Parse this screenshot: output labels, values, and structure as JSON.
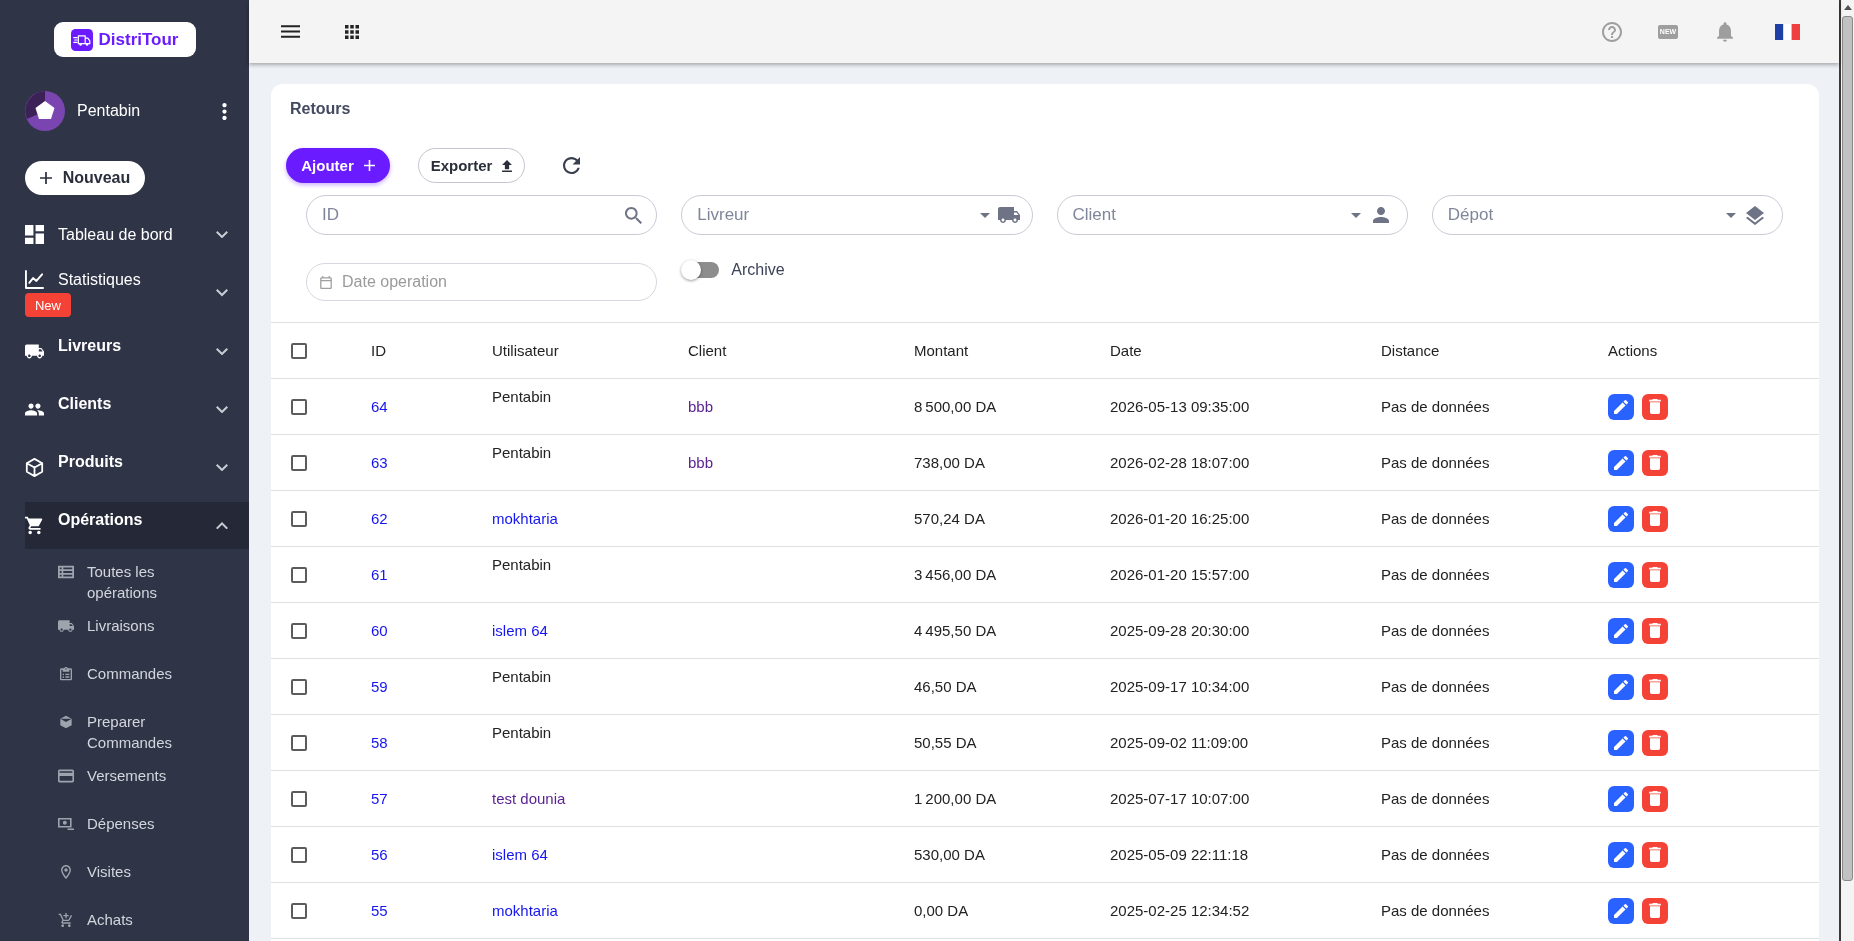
{
  "sidebar": {
    "brand": "DistriTour",
    "user": {
      "name": "Pentabin"
    },
    "new_button": {
      "label": "Nouveau"
    },
    "items": [
      {
        "label": "Tableau de bord",
        "bold": false,
        "selected": false,
        "expanded": false
      },
      {
        "label": "Statistiques",
        "badge": "New",
        "bold": false,
        "selected": false,
        "expanded": false
      },
      {
        "label": "Livreurs",
        "bold": true,
        "selected": false,
        "expanded": false
      },
      {
        "label": "Clients",
        "bold": true,
        "selected": false,
        "expanded": false
      },
      {
        "label": "Produits",
        "bold": true,
        "selected": false,
        "expanded": false
      },
      {
        "label": "Opérations",
        "bold": true,
        "selected": true,
        "expanded": true,
        "children": [
          {
            "label": "Toutes les opérations",
            "selected": false
          },
          {
            "label": "Livraisons",
            "selected": false
          },
          {
            "label": "Commandes",
            "selected": false
          },
          {
            "label": "Preparer Commandes",
            "selected": false
          },
          {
            "label": "Versements",
            "selected": false
          },
          {
            "label": "Dépenses",
            "selected": false
          },
          {
            "label": "Visites",
            "selected": false
          },
          {
            "label": "Achats",
            "selected": false
          }
        ]
      }
    ]
  },
  "topbar": {
    "news_badge": "NEW"
  },
  "page": {
    "title": "Retours",
    "buttons": [
      {
        "label": "Ajouter",
        "kind": "primary"
      },
      {
        "label": "Exporter",
        "kind": "outlined"
      }
    ],
    "filters": [
      {
        "kind": "search",
        "placeholder": "ID"
      },
      {
        "kind": "select",
        "placeholder": "Livreur"
      },
      {
        "kind": "select",
        "placeholder": "Client"
      },
      {
        "kind": "select",
        "placeholder": "Dépot"
      },
      {
        "kind": "date",
        "placeholder": "Date operation"
      }
    ],
    "archive_toggle": {
      "label": "Archive",
      "on": false
    }
  },
  "table": {
    "select_all": {
      "checked": false
    },
    "columns": [
      "ID",
      "Utilisateur",
      "Client",
      "Montant",
      "Date",
      "Distance",
      "Actions"
    ],
    "rows": [
      {
        "checked": false,
        "id": "64",
        "user": {
          "kind": "text",
          "text": "Pentabin"
        },
        "client": {
          "text": "bbb",
          "visited": true
        },
        "amount": "8 500,00 DA",
        "date": "2026-05-13 09:35:00",
        "distance": "Pas de données"
      },
      {
        "checked": false,
        "id": "63",
        "user": {
          "kind": "text",
          "text": "Pentabin"
        },
        "client": {
          "text": "bbb",
          "visited": true
        },
        "amount": "738,00 DA",
        "date": "2026-02-28 18:07:00",
        "distance": "Pas de données"
      },
      {
        "checked": false,
        "id": "62",
        "user": {
          "kind": "link",
          "text": "mokhtaria",
          "visited": false
        },
        "amount": "570,24 DA",
        "date": "2026-01-20 16:25:00",
        "distance": "Pas de données"
      },
      {
        "checked": false,
        "id": "61",
        "user": {
          "kind": "text",
          "text": "Pentabin"
        },
        "amount": "3 456,00 DA",
        "date": "2026-01-20 15:57:00",
        "distance": "Pas de données"
      },
      {
        "checked": false,
        "id": "60",
        "user": {
          "kind": "link",
          "text": "islem 64",
          "visited": false
        },
        "amount": "4 495,50 DA",
        "date": "2025-09-28 20:30:00",
        "distance": "Pas de données"
      },
      {
        "checked": false,
        "id": "59",
        "user": {
          "kind": "text",
          "text": "Pentabin"
        },
        "amount": "46,50 DA",
        "date": "2025-09-17 10:34:00",
        "distance": "Pas de données"
      },
      {
        "checked": false,
        "id": "58",
        "user": {
          "kind": "text",
          "text": "Pentabin"
        },
        "amount": "50,55 DA",
        "date": "2025-09-02 11:09:00",
        "distance": "Pas de données"
      },
      {
        "checked": false,
        "id": "57",
        "user": {
          "kind": "link",
          "text": "test dounia",
          "visited": true
        },
        "amount": "1 200,00 DA",
        "date": "2025-07-17 10:07:00",
        "distance": "Pas de données"
      },
      {
        "checked": false,
        "id": "56",
        "user": {
          "kind": "link",
          "text": "islem 64",
          "visited": false
        },
        "amount": "530,00 DA",
        "date": "2025-05-09 22:11:18",
        "distance": "Pas de données"
      },
      {
        "checked": false,
        "id": "55",
        "user": {
          "kind": "link",
          "text": "mokhtaria",
          "visited": false
        },
        "amount": "0,00 DA",
        "date": "2025-02-25 12:34:52",
        "distance": "Pas de données"
      }
    ]
  }
}
